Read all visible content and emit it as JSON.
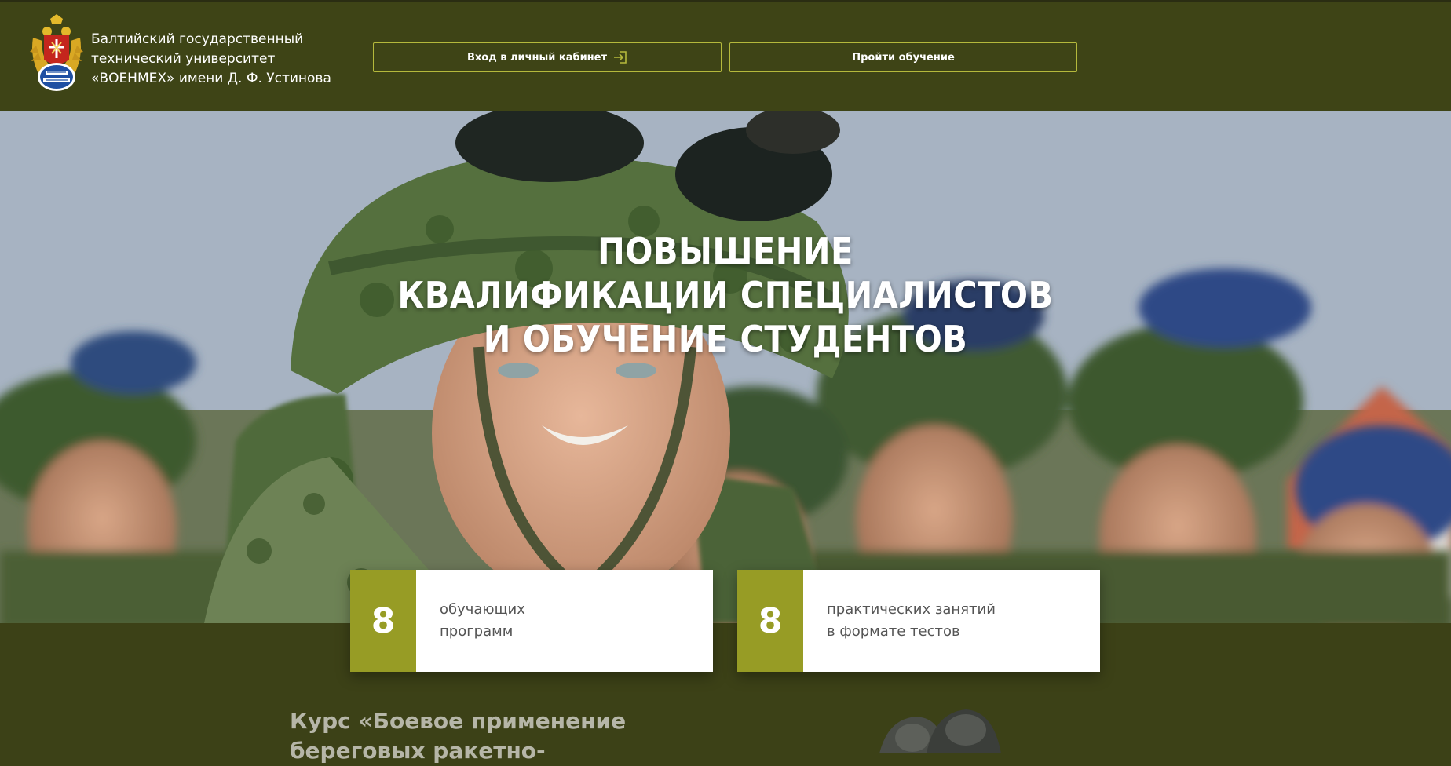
{
  "header": {
    "university_name_lines": [
      "Балтийский государственный",
      "технический университет",
      "«ВОЕНМЕХ» имени Д. Ф. Устинова"
    ],
    "login_button": "Вход в личный кабинет",
    "train_button": "Пройти обучение"
  },
  "hero": {
    "title_lines": [
      "ПОВЫШЕНИЕ",
      "КВАЛИФИКАЦИИ СПЕЦИАЛИСТОВ",
      "И ОБУЧЕНИЕ СТУДЕНТОВ"
    ]
  },
  "stats": [
    {
      "number": "8",
      "line1": "обучающих",
      "line2": "программ"
    },
    {
      "number": "8",
      "line1": "практических занятий",
      "line2": "в формате тестов"
    }
  ],
  "course": {
    "title_lines": [
      "Курс «Боевое применение",
      "береговых ракетно-"
    ]
  },
  "colors": {
    "header_bg": "#3e4416",
    "page_bg": "#3c4117",
    "accent": "#979c25",
    "button_border": "#b5b93c"
  },
  "icons": {
    "logo": "university-crest-icon",
    "login": "login-arrow-icon"
  }
}
